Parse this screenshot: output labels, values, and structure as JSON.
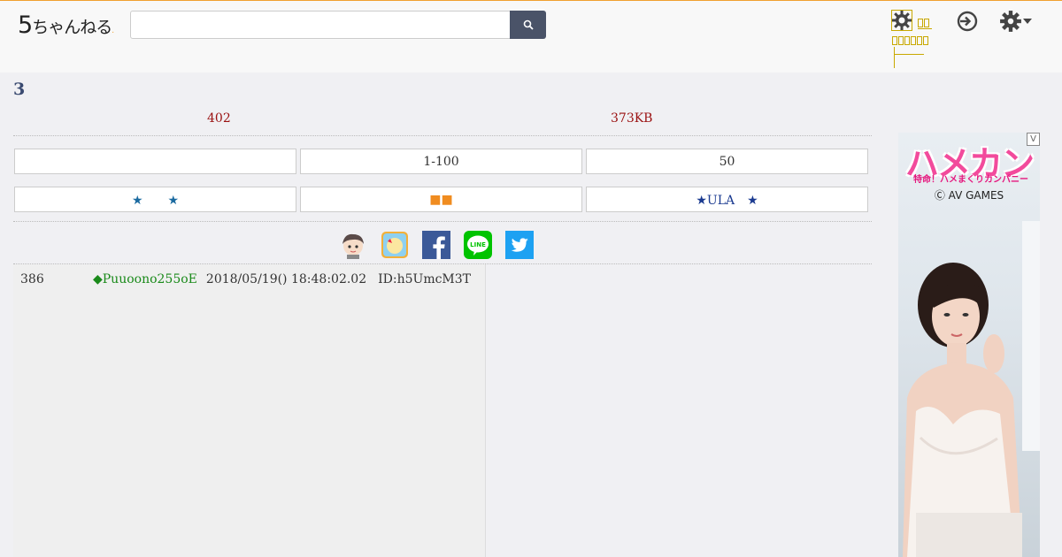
{
  "header": {
    "logo_big": "5",
    "logo_text": "ちゃんねる",
    "search_placeholder": ""
  },
  "thread": {
    "title": "3",
    "res_count": "402",
    "size": "373KB"
  },
  "nav_row1": [
    "",
    "1-100",
    "50"
  ],
  "nav_row2": [
    "★　　★",
    "■■",
    "★ULA　★"
  ],
  "post": {
    "number": "386",
    "name": "◆Puuoono255oE",
    "date": "2018/05/19() 18:48:02.02",
    "id": "ID:h5UmcM3T"
  },
  "ad": {
    "logo": "ハメカン",
    "sub": "特命！ハメまくりカンパニー",
    "copyright": "Ⓒ AV GAMES",
    "badge": "V"
  },
  "colors": {
    "accent_orange": "#f0a030",
    "title_blue": "#3a4a70",
    "meta_red": "#9a1010",
    "name_green": "#1a8a1a",
    "search_btn": "#4a5368"
  },
  "icons": [
    "search-icon",
    "gear-icon",
    "login-icon",
    "settings-gear-icon",
    "chevron-down-icon",
    "avatar-icon",
    "app-icon",
    "facebook-icon",
    "line-icon",
    "twitter-icon"
  ]
}
